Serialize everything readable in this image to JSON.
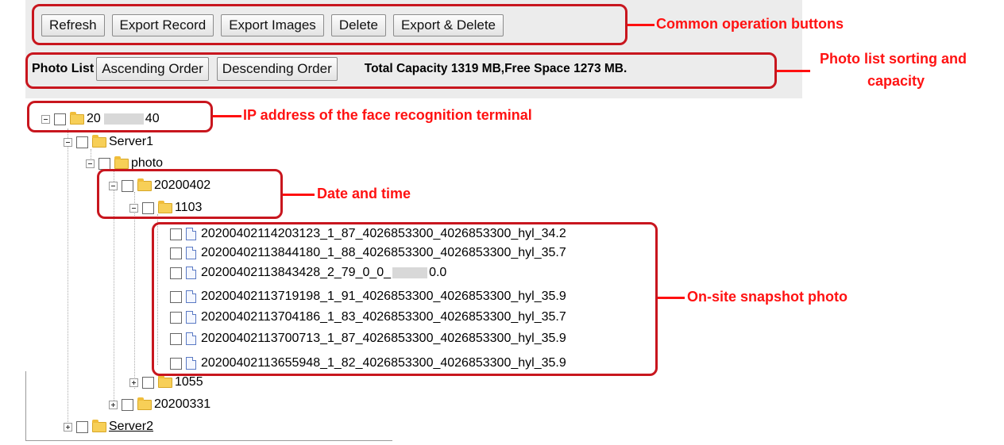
{
  "toolbar": {
    "refresh": "Refresh",
    "export_record": "Export Record",
    "export_images": "Export Images",
    "delete": "Delete",
    "export_delete": "Export & Delete"
  },
  "sortbar": {
    "label": "Photo List",
    "ascending": "Ascending Order",
    "descending": "Descending Order",
    "capacity": "Total Capacity 1319 MB,Free Space 1273 MB."
  },
  "tree": {
    "root_prefix": "20",
    "root_suffix": "40",
    "server1": "Server1",
    "photo": "photo",
    "date": "20200402",
    "time": "1103",
    "files": [
      "20200402114203123_1_87_4026853300_4026853300_hyl_34.2",
      "20200402113844180_1_88_4026853300_4026853300_hyl_35.7",
      "20200402113843428_2_79_0_0_",
      "20200402113719198_1_91_4026853300_4026853300_hyl_35.9",
      "20200402113704186_1_83_4026853300_4026853300_hyl_35.7",
      "20200402113700713_1_87_4026853300_4026853300_hyl_35.9",
      "20200402113655948_1_82_4026853300_4026853300_hyl_35.9"
    ],
    "file3_suffix": "0.0",
    "folder_1055": "1055",
    "folder_20200331": "20200331",
    "server2": "Server2"
  },
  "annotations": {
    "common_buttons": "Common operation buttons",
    "sorting_line1": "Photo list sorting and",
    "sorting_line2": "capacity",
    "ip_address": "IP address of the face recognition terminal",
    "date_time": "Date and time",
    "snapshot": "On-site snapshot photo"
  },
  "colors": {
    "annotation_red": "#ff1212",
    "box_red": "#c8161e",
    "folder_yellow": "#f7cf57"
  }
}
